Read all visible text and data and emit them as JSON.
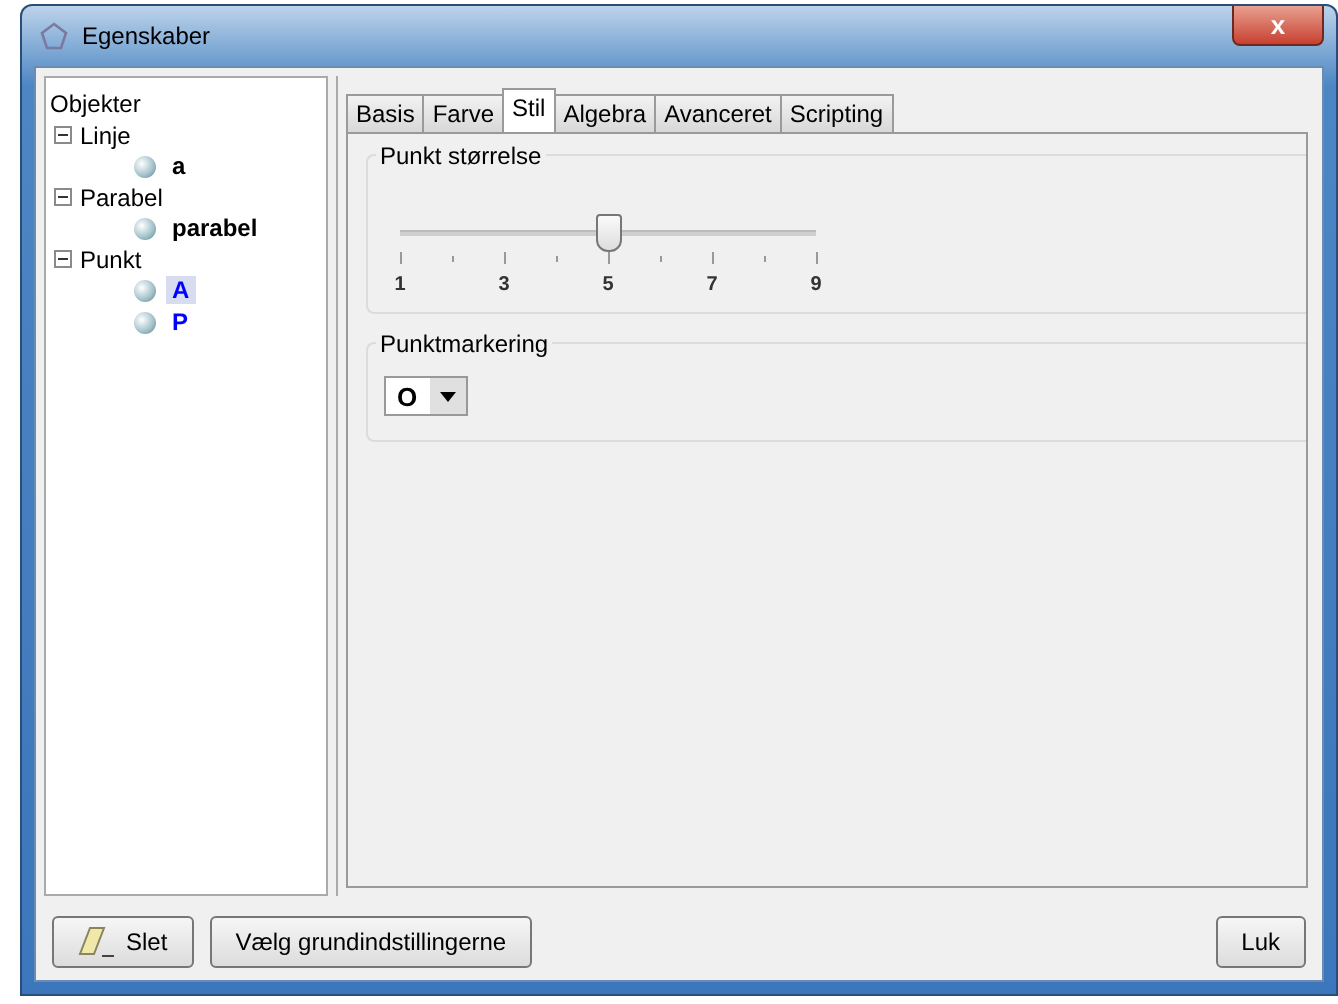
{
  "window": {
    "title": "Egenskaber",
    "close": "x"
  },
  "tree": {
    "root": "Objekter",
    "children": [
      {
        "label": "Linje",
        "expanded": true,
        "children": [
          {
            "label": "a",
            "color": "#000000",
            "selected": false
          }
        ]
      },
      {
        "label": "Parabel",
        "expanded": true,
        "children": [
          {
            "label": "parabel",
            "color": "#000000",
            "selected": false
          }
        ]
      },
      {
        "label": "Punkt",
        "expanded": true,
        "children": [
          {
            "label": "A",
            "color": "#0000ff",
            "selected": true
          },
          {
            "label": "P",
            "color": "#0000ff",
            "selected": false
          }
        ]
      }
    ]
  },
  "tabs": [
    {
      "label": "Basis",
      "selected": false
    },
    {
      "label": "Farve",
      "selected": false
    },
    {
      "label": "Stil",
      "selected": true
    },
    {
      "label": "Algebra",
      "selected": false
    },
    {
      "label": "Avanceret",
      "selected": false
    },
    {
      "label": "Scripting",
      "selected": false
    }
  ],
  "point_size": {
    "title": "Punkt størrelse",
    "level": 0.5,
    "tick_labels": [
      "1",
      "3",
      "5",
      "7",
      "9"
    ]
  },
  "point_style": {
    "title": "Punktmarkering",
    "value": "O"
  },
  "buttons": [
    {
      "label": "Slet",
      "kind": "eraser"
    },
    {
      "label": "Vælg grundindstillingerne",
      "kind": "plain"
    },
    {
      "label": "Luk",
      "kind": "plain"
    }
  ]
}
